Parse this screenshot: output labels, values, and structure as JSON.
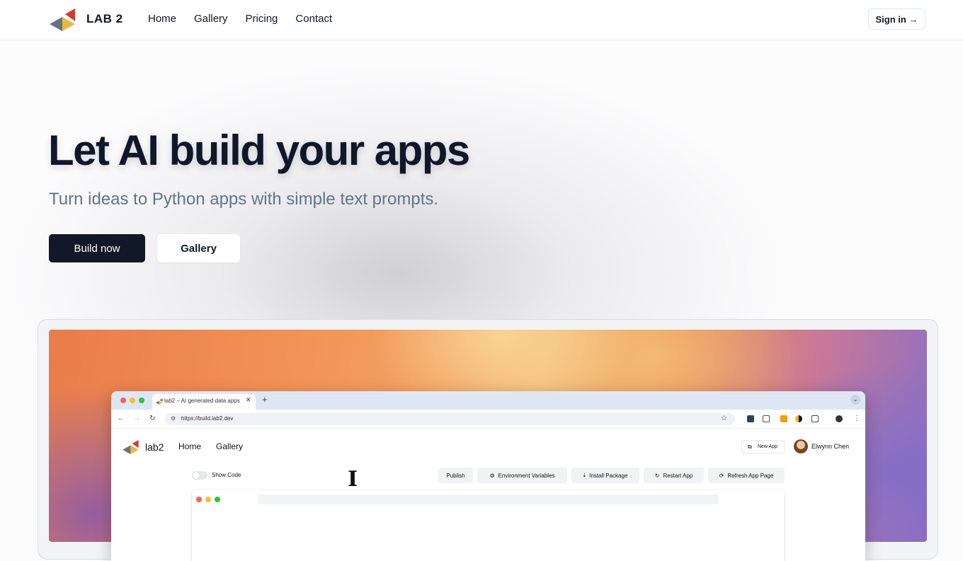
{
  "nav": {
    "brand": "LAB 2",
    "links": [
      "Home",
      "Gallery",
      "Pricing",
      "Contact"
    ],
    "sign_in": "Sign in →"
  },
  "hero": {
    "title": "Let AI build your apps",
    "subtitle": "Turn ideas to Python apps with simple text prompts.",
    "primary_button": "Build now",
    "secondary_button": "Gallery"
  },
  "showcase": {
    "browser": {
      "tab_title": "lab2 – AI generated data apps",
      "url": "https://build.lab2.dev"
    },
    "app": {
      "brand": "lab2",
      "nav": [
        "Home",
        "Gallery"
      ],
      "new_app": "New App",
      "user_name": "Elwynn Chen",
      "show_code": "Show Code",
      "actions": [
        "Publish",
        "Environment Variables",
        "Install Package",
        "Restart App",
        "Refresh App Page"
      ]
    }
  },
  "colors": {
    "primary": "#111827",
    "muted_text": "#64748b",
    "logo_red": "#d8382b",
    "logo_yellow": "#e7b94a",
    "logo_gray": "#6b7280"
  }
}
